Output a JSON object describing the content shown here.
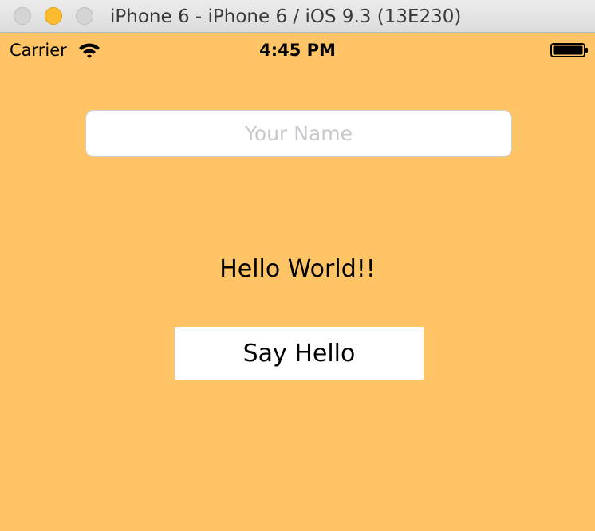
{
  "window": {
    "title": "iPhone 6 - iPhone 6 / iOS 9.3 (13E230)"
  },
  "status_bar": {
    "carrier": "Carrier",
    "time": "4:45 PM",
    "icons": [
      "wifi-icon",
      "battery-icon"
    ]
  },
  "form": {
    "name_placeholder": "Your Name",
    "name_value": ""
  },
  "greeting": "Hello World!!",
  "button": {
    "say_hello_label": "Say Hello"
  },
  "colors": {
    "background": "#ffc466",
    "field_background": "#ffffff",
    "button_background": "#ffffff",
    "text": "#000000"
  }
}
